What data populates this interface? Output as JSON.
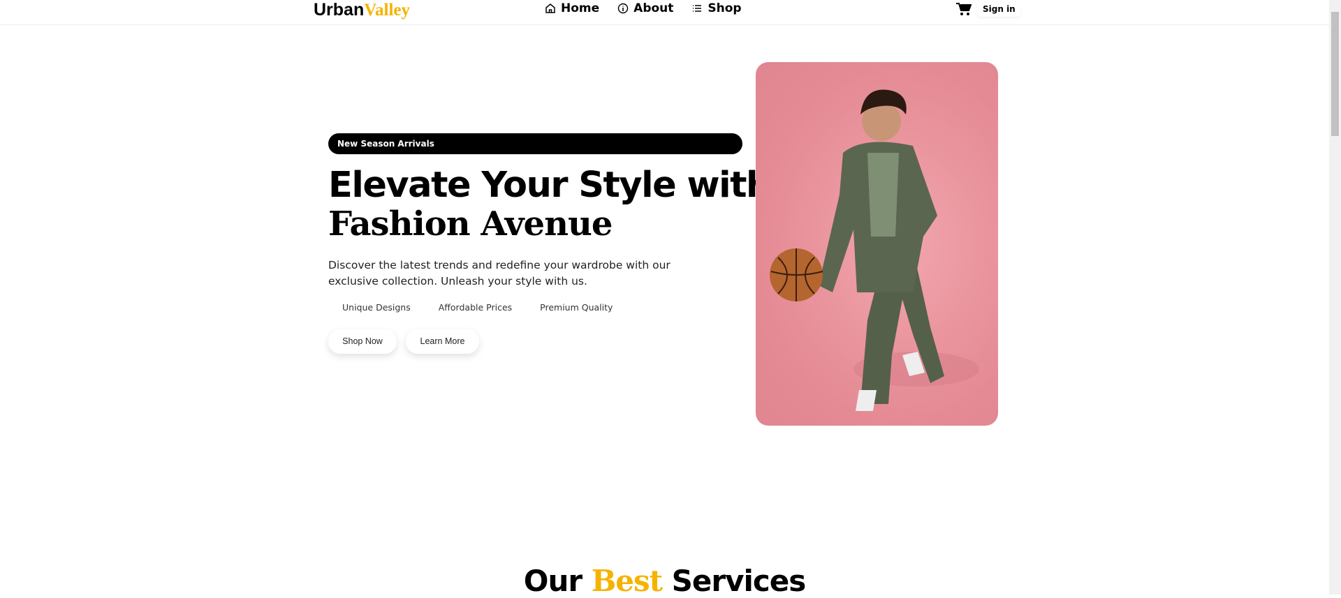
{
  "header": {
    "logo_part1": "Urban",
    "logo_part2": "Valley",
    "nav": [
      {
        "label": "Home",
        "icon": "home-icon"
      },
      {
        "label": "About",
        "icon": "info-icon"
      },
      {
        "label": "Shop",
        "icon": "list-icon"
      }
    ],
    "signin_label": "Sign in"
  },
  "hero": {
    "badge": "New Season Arrivals",
    "title_line1": "Elevate Your Style with",
    "title_line2": "Fashion Avenue",
    "description": "Discover the latest trends and redefine your wardrobe with our exclusive collection. Unleash your style with us.",
    "features": [
      "Unique Designs",
      "Affordable Prices",
      "Premium Quality"
    ],
    "shop_now": "Shop Now",
    "learn_more": "Learn More"
  },
  "services": {
    "title_part1": "Our",
    "title_part2": "Best",
    "title_part3": "Services"
  },
  "colors": {
    "accent": "#f5b301",
    "photo_bg": "#e48a94"
  }
}
